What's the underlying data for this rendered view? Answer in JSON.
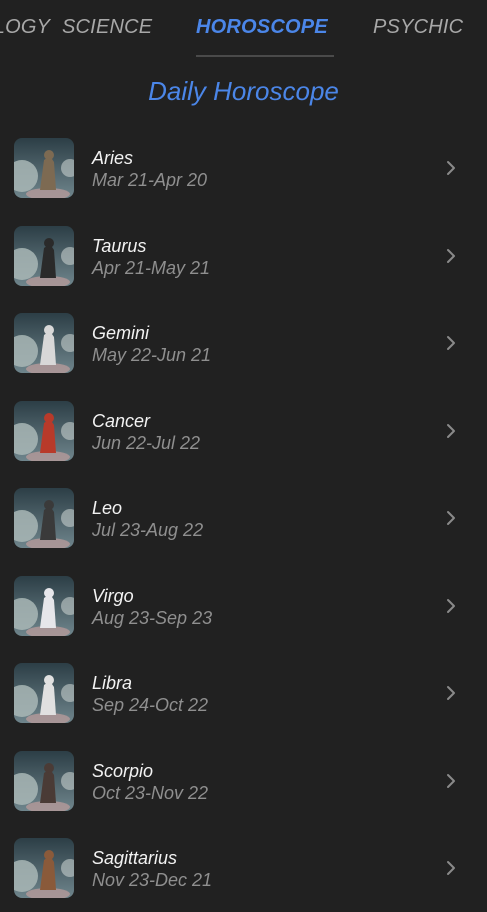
{
  "tabs": [
    {
      "label": "OLOGY",
      "active": false
    },
    {
      "label": "SCIENCE",
      "active": false
    },
    {
      "label": "HOROSCOPE",
      "active": true
    },
    {
      "label": "PSYCHIC",
      "active": false
    }
  ],
  "page_title": "Daily Horoscope",
  "colors": {
    "background": "#212121",
    "accent": "#4b86e8",
    "primary_text": "#f2f2f2",
    "secondary_text": "#8f8f8f"
  },
  "signs": [
    {
      "name": "Aries",
      "dates": "Mar 21-Apr 20",
      "icon": "aries-ram-icon"
    },
    {
      "name": "Taurus",
      "dates": "Apr 21-May 21",
      "icon": "taurus-bull-icon"
    },
    {
      "name": "Gemini",
      "dates": "May 22-Jun 21",
      "icon": "gemini-twins-icon"
    },
    {
      "name": "Cancer",
      "dates": "Jun 22-Jul 22",
      "icon": "cancer-crab-icon"
    },
    {
      "name": "Leo",
      "dates": "Jul 23-Aug 22",
      "icon": "leo-lion-icon"
    },
    {
      "name": "Virgo",
      "dates": "Aug 23-Sep 23",
      "icon": "virgo-maiden-icon"
    },
    {
      "name": "Libra",
      "dates": "Sep 24-Oct 22",
      "icon": "libra-scales-icon"
    },
    {
      "name": "Scorpio",
      "dates": "Oct 23-Nov 22",
      "icon": "scorpio-scorpion-icon"
    },
    {
      "name": "Sagittarius",
      "dates": "Nov 23-Dec 21",
      "icon": "sagittarius-archer-icon"
    }
  ]
}
